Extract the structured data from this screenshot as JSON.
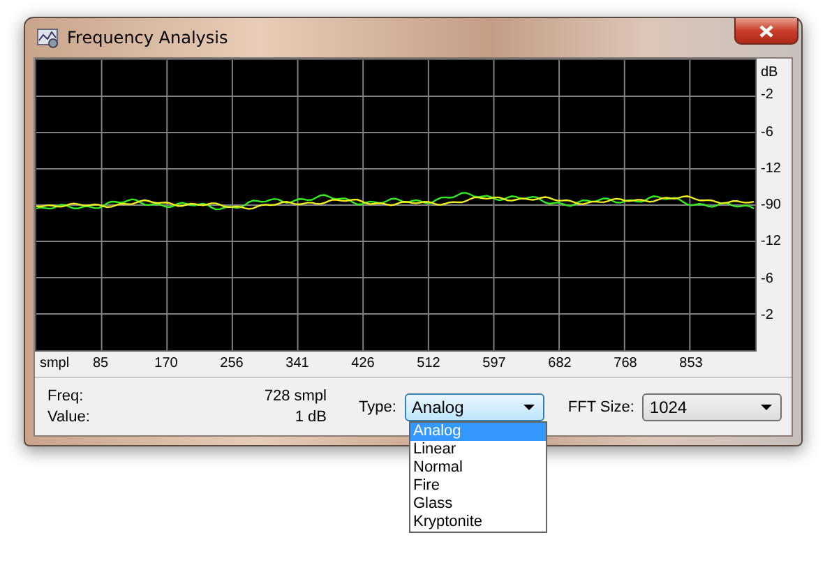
{
  "window": {
    "title": "Frequency Analysis"
  },
  "chart": {
    "y_unit": "dB",
    "y_labels": [
      "-2",
      "-6",
      "-12",
      "-90",
      "-12",
      "-6",
      "-2"
    ],
    "x_unit": "smpl",
    "x_labels": [
      "85",
      "170",
      "256",
      "341",
      "426",
      "512",
      "597",
      "682",
      "768",
      "853"
    ]
  },
  "readouts": [
    {
      "label": "Freq:",
      "value": "728 smpl"
    },
    {
      "label": "Value:",
      "value": "1 dB"
    }
  ],
  "type_select": {
    "label": "Type:",
    "value": "Analog",
    "expanded": true,
    "options": [
      {
        "label": "Analog",
        "selected": true
      },
      {
        "label": "Linear",
        "selected": false
      },
      {
        "label": "Normal",
        "selected": false
      },
      {
        "label": "Fire",
        "selected": false
      },
      {
        "label": "Glass",
        "selected": false
      },
      {
        "label": "Kryptonite",
        "selected": false
      }
    ]
  },
  "fft_select": {
    "label": "FFT Size:",
    "value": "1024"
  }
}
